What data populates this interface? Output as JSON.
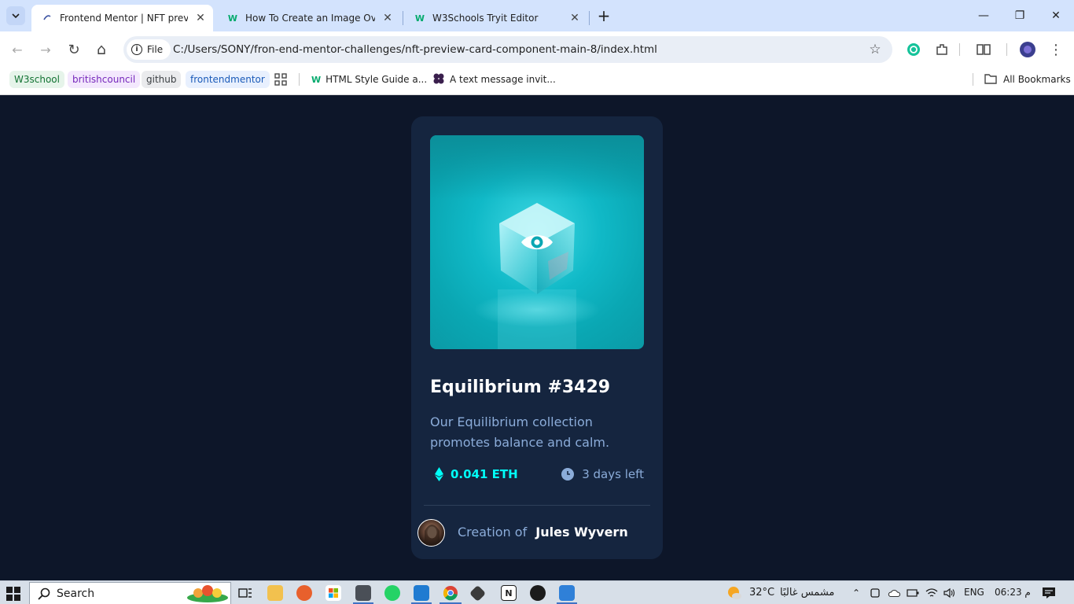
{
  "browser": {
    "tabs": [
      {
        "title": "Frontend Mentor | NFT preview",
        "active": true
      },
      {
        "title": "How To Create an Image Overla",
        "active": false
      },
      {
        "title": "W3Schools Tryit Editor",
        "active": false
      }
    ],
    "tab_close_glyph": "✕",
    "new_tab_glyph": "+",
    "window_controls": {
      "minimize": "—",
      "restore": "❐",
      "close": "✕"
    },
    "nav": {
      "back": "←",
      "forward": "→",
      "reload": "↻",
      "home": "⌂"
    },
    "address": {
      "chip_label": "File",
      "info_glyph": "i",
      "url": "C:/Users/SONY/fron-end-mentor-challenges/nft-preview-card-component-main-8/index.html",
      "star_glyph": "☆"
    },
    "bookmarks": [
      {
        "label": "W3school",
        "bg": "#e6f4ea",
        "color": "#137333"
      },
      {
        "label": "britishcouncil",
        "bg": "#f3e8fd",
        "color": "#7627bb"
      },
      {
        "label": "github",
        "bg": "#eaebed",
        "color": "#3c4043"
      },
      {
        "label": "frontendmentor",
        "bg": "#e8f0fe",
        "color": "#1a5ab8"
      }
    ],
    "bookmark_links": [
      {
        "label": "HTML Style Guide a..."
      },
      {
        "label": "A text message invit..."
      }
    ],
    "all_bookmarks": "All Bookmarks"
  },
  "card": {
    "title": "Equilibrium #3429",
    "description": "Our Equilibrium collection promotes balance and calm.",
    "price": "0.041 ETH",
    "time_left": "3 days left",
    "creator_prefix": "Creation of",
    "creator_name": "Jules Wyvern",
    "colors": {
      "page_bg": "#0d1629",
      "card_bg": "#15253f",
      "cyan": "#00fff8",
      "soft_blue": "#8bacd9",
      "line": "#2e405a"
    }
  },
  "taskbar": {
    "search_label": "Search",
    "weather_temp": "32°C",
    "weather_desc": "مشمس غالبًا",
    "language": "ENG",
    "clock": "06:23 م",
    "apps": [
      "file-explorer-icon",
      "firefox-icon",
      "microsoft-store-icon",
      "app-icon",
      "whatsapp-icon",
      "vscode-icon",
      "chrome-icon",
      "git-icon",
      "notion-icon",
      "chatgpt-icon",
      "photos-icon"
    ]
  }
}
